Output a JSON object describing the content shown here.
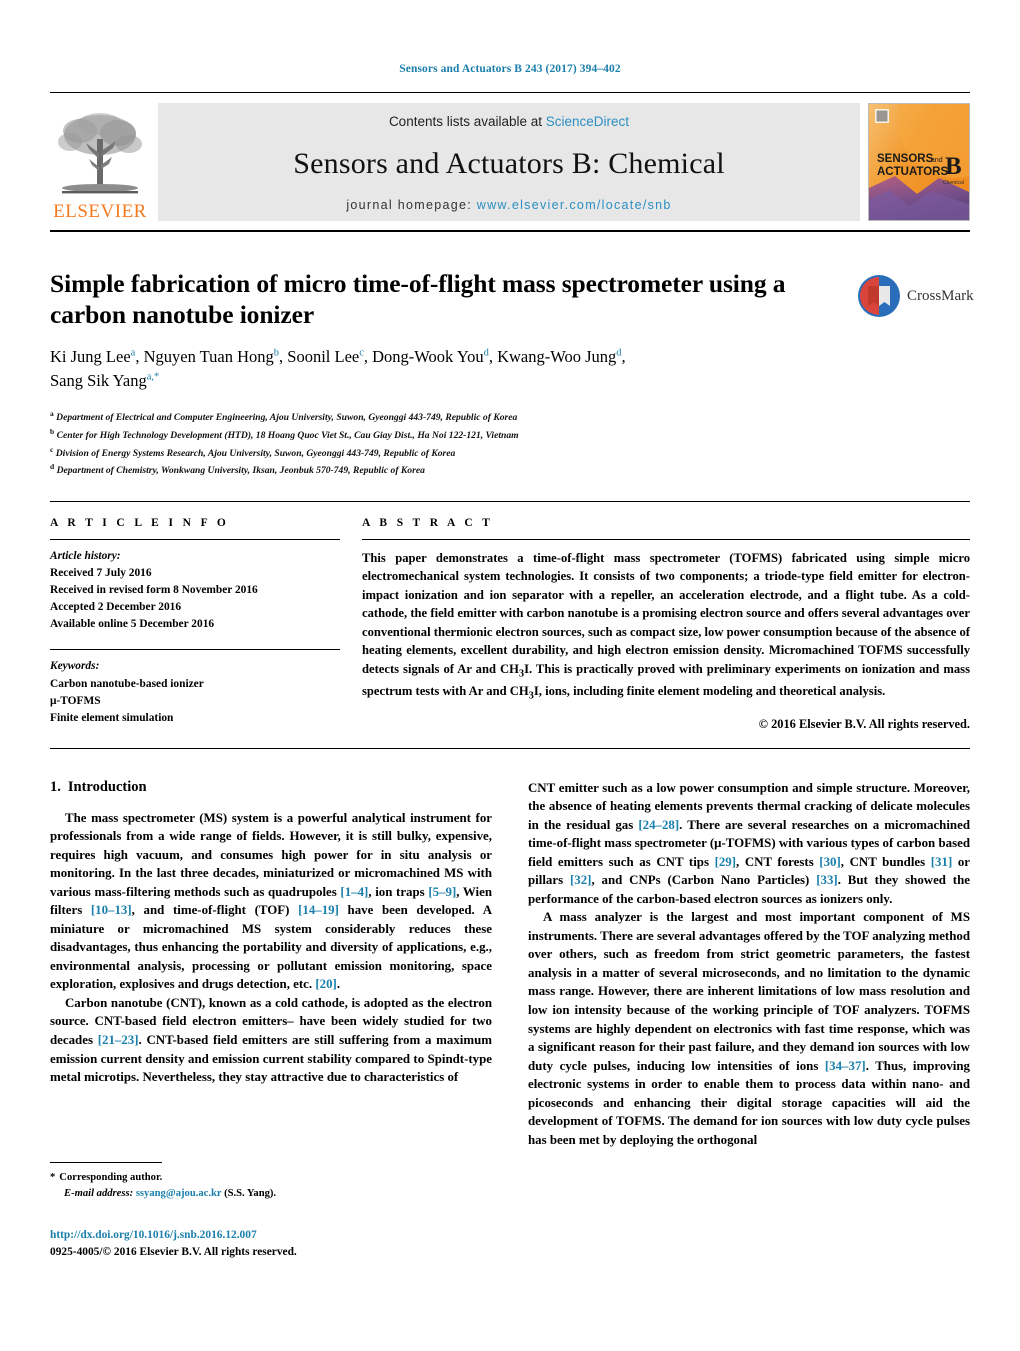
{
  "running_head": "Sensors and Actuators B 243 (2017) 394–402",
  "banner": {
    "publisher": "ELSEVIER",
    "contents_prefix": "Contents lists available at ",
    "contents_link": "ScienceDirect",
    "journal_title": "Sensors and Actuators B: Chemical",
    "homepage_prefix": "journal homepage: ",
    "homepage_url": "www.elsevier.com/locate/snb",
    "cover": {
      "line1": "SENSORS",
      "line1_suffix": "and",
      "line2": "ACTUATORS",
      "letter": "B",
      "sub": "Chemical",
      "color_top": "#f5a623",
      "color_bottom": "#6a4a8c"
    }
  },
  "article": {
    "title": "Simple fabrication of micro time-of-flight mass spectrometer using a carbon nanotube ionizer",
    "authors_line1": "Ki Jung Lee",
    "authors": [
      {
        "name": "Ki Jung Lee",
        "sup": "a"
      },
      {
        "name": "Nguyen Tuan Hong",
        "sup": "b"
      },
      {
        "name": "Soonil Lee",
        "sup": "c"
      },
      {
        "name": "Dong-Wook You",
        "sup": "d"
      },
      {
        "name": "Kwang-Woo Jung",
        "sup": "d"
      },
      {
        "name": "Sang Sik Yang",
        "sup": "a,*"
      }
    ],
    "affiliations": [
      {
        "sup": "a",
        "text": "Department of Electrical and Computer Engineering, Ajou University, Suwon, Gyeonggi 443-749, Republic of Korea"
      },
      {
        "sup": "b",
        "text": "Center for High Technology Development (HTD), 18 Hoang Quoc Viet St., Cau Giay Dist., Ha Noi 122-121, Vietnam"
      },
      {
        "sup": "c",
        "text": "Division of Energy Systems Research, Ajou University, Suwon, Gyeonggi 443-749, Republic of Korea"
      },
      {
        "sup": "d",
        "text": "Department of Chemistry, Wonkwang University, Iksan, Jeonbuk 570-749, Republic of Korea"
      }
    ],
    "crossmark_label": "CrossMark"
  },
  "article_info": {
    "heading": "A R T I C L E    I N F O",
    "history_label": "Article history:",
    "history": [
      "Received 7 July 2016",
      "Received in revised form 8 November 2016",
      "Accepted 2 December 2016",
      "Available online 5 December 2016"
    ],
    "keywords_label": "Keywords:",
    "keywords": [
      "Carbon nanotube-based ionizer",
      "μ-TOFMS",
      "Finite element simulation"
    ]
  },
  "abstract": {
    "heading": "A B S T R A C T",
    "paragraph_part1": "This paper demonstrates a time-of-flight mass spectrometer (TOFMS) fabricated using simple micro electromechanical system technologies. It consists of two components; a triode-type field emitter for electron-impact ionization and ion separator with a repeller, an acceleration electrode, and a flight tube. As a cold-cathode, the field emitter with carbon nanotube is a promising electron source and offers several advantages over conventional thermionic electron sources, such as compact size, low power consumption because of the absence of heating elements, excellent durability, and high electron emission density. Micromachined TOFMS successfully detects signals of Ar and CH",
    "sub1": "3",
    "paragraph_part2": "I. This is practically proved with preliminary experiments on ionization and mass spectrum tests with Ar and CH",
    "sub2": "3",
    "paragraph_part3": "I, ions, including finite element modeling and theoretical analysis.",
    "copyright": "© 2016 Elsevier B.V. All rights reserved."
  },
  "section": {
    "number": "1.",
    "title": "Introduction"
  },
  "body": {
    "left": [
      {
        "segments": [
          {
            "t": "The mass spectrometer (MS) system is a powerful analytical instrument for professionals from a wide range of fields. However, it is still bulky, expensive, requires high vacuum, and consumes high power for in situ analysis or monitoring. In the last three decades, miniaturized or micromachined MS with various mass-filtering methods such as quadrupoles "
          },
          {
            "t": "[1–4]",
            "cite": true
          },
          {
            "t": ", ion traps "
          },
          {
            "t": "[5–9]",
            "cite": true
          },
          {
            "t": ", Wien filters "
          },
          {
            "t": "[10–13]",
            "cite": true
          },
          {
            "t": ", and time-of-flight (TOF) "
          },
          {
            "t": "[14–19]",
            "cite": true
          },
          {
            "t": " have been developed. A miniature or micromachined MS system considerably reduces these disadvantages, thus enhancing the portability and diversity of applications, e.g., environmental analysis, processing or pollutant emission monitoring, space exploration, explosives and drugs detection, etc. "
          },
          {
            "t": "[20]",
            "cite": true
          },
          {
            "t": "."
          }
        ]
      },
      {
        "segments": [
          {
            "t": "Carbon nanotube (CNT), known as a cold cathode, is adopted as the electron source. CNT-based field electron emitters– have been widely studied for two decades "
          },
          {
            "t": "[21–23]",
            "cite": true
          },
          {
            "t": ". CNT-based field emitters are still suffering from a maximum emission current density and emission current stability compared to Spindt-type metal microtips. Nevertheless, they stay attractive due to characteristics of"
          }
        ]
      }
    ],
    "right": [
      {
        "segments": [
          {
            "t": "CNT emitter such as a low power consumption and simple structure. Moreover, the absence of heating elements prevents thermal cracking of delicate molecules in the residual gas "
          },
          {
            "t": "[24–28]",
            "cite": true
          },
          {
            "t": ". There are several researches on a micromachined time-of-flight mass spectrometer (μ-TOFMS) with various types of carbon based field emitters such as CNT tips "
          },
          {
            "t": "[29]",
            "cite": true
          },
          {
            "t": ", CNT forests "
          },
          {
            "t": "[30]",
            "cite": true
          },
          {
            "t": ", CNT bundles "
          },
          {
            "t": "[31]",
            "cite": true
          },
          {
            "t": " or pillars "
          },
          {
            "t": "[32]",
            "cite": true
          },
          {
            "t": ", and CNPs (Carbon Nano Particles) "
          },
          {
            "t": "[33]",
            "cite": true
          },
          {
            "t": ". But they showed the performance of the carbon-based electron sources as ionizers only."
          }
        ]
      },
      {
        "segments": [
          {
            "t": "A mass analyzer is the largest and most important component of MS instruments. There are several advantages offered by the TOF analyzing method over others, such as freedom from strict geometric parameters, the fastest analysis in a matter of several microseconds, and no limitation to the dynamic mass range. However, there are inherent limitations of low mass resolution and low ion intensity because of the working principle of TOF analyzers. TOFMS systems are highly dependent on electronics with fast time response, which was a significant reason for their past failure, and they demand ion sources with low duty cycle pulses, inducing low intensities of ions "
          },
          {
            "t": "[34–37]",
            "cite": true
          },
          {
            "t": ". Thus, improving electronic systems in order to enable them to process data within nano- and picoseconds and enhancing their digital storage capacities will aid the development of TOFMS. The demand for ion sources with low duty cycle pulses has been met by deploying the orthogonal"
          }
        ]
      }
    ]
  },
  "footnote": {
    "star": "*",
    "corresponding": "Corresponding author.",
    "email_label": "E-mail address:",
    "email": "ssyang@ajou.ac.kr",
    "email_suffix": "(S.S. Yang)."
  },
  "footer": {
    "doi": "http://dx.doi.org/10.1016/j.snb.2016.12.007",
    "issn_line": "0925-4005/© 2016 Elsevier B.V. All rights reserved."
  },
  "colors": {
    "link_blue": "#1a7fab",
    "elsevier_orange": "#f47a20",
    "banner_grey": "#e7e7e7"
  }
}
